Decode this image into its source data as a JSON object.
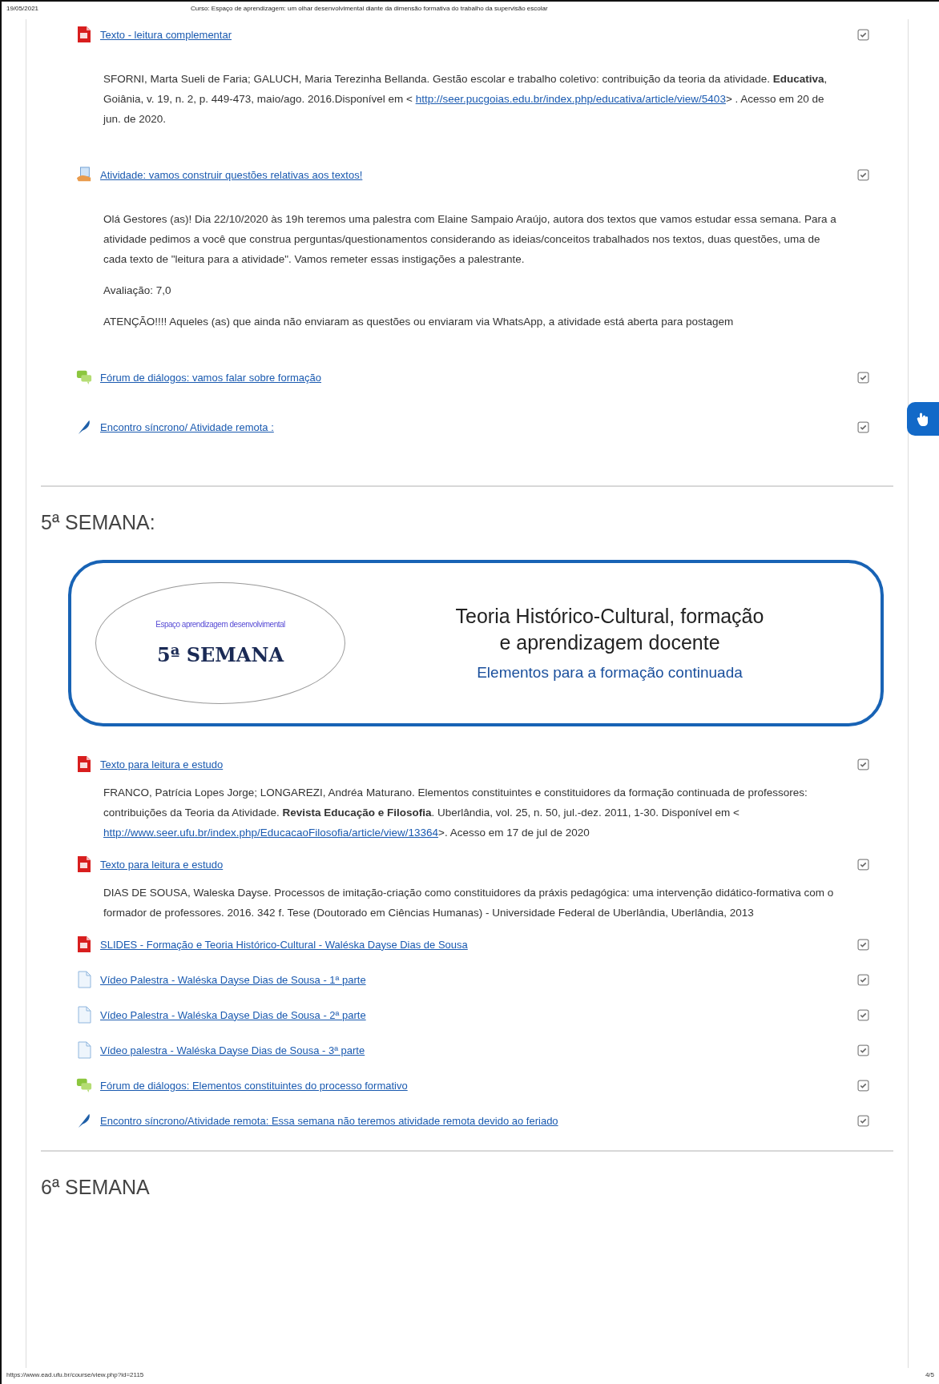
{
  "print_header": {
    "date": "19/05/2021",
    "title": "Curso: Espaço de aprendizagem: um olhar desenvolvimental diante da dimensão formativa do trabalho da supervisão escolar"
  },
  "intro_blocks": [
    {
      "kind": "pdf",
      "label": "Texto - leitura complementar",
      "checked": true
    },
    {
      "kind": "citation",
      "before": "SFORNI, Marta Sueli de Faria; GALUCH, Maria Terezinha Bellanda. Gestão escolar e trabalho coletivo: contribuição da teoria da atividade. **Educativa**, Goiânia, v. 19, n. 2, p. 449-473, maio/ago. 2016.Disponível em <",
      "link": "http://seer.pucgoias.edu.br/index.php/educativa/article/view/5403",
      "after": "> . Acesso em 20 de jun. de 2020."
    },
    {
      "kind": "assignment",
      "label": "Atividade: vamos construir questões relativas aos textos!",
      "checked": true
    },
    {
      "kind": "paragraph",
      "text": "Olá Gestores (as)! Dia 22/10/2020 às 19h teremos uma palestra com Elaine Sampaio Araújo, autora dos textos que vamos estudar essa semana. Para a atividade pedimos a você que construa perguntas/questionamentos considerando as ideias/conceitos trabalhados nos textos, duas questões, uma de cada texto de \"leitura para a atividade\". Vamos remeter essas instigações a palestrante."
    },
    {
      "kind": "paragraph",
      "text": "Avaliação: 7,0"
    },
    {
      "kind": "paragraph",
      "text": "ATENÇÃO!!!! Aqueles (as) que ainda não enviaram as questões ou enviaram  via WhatsApp, a atividade está aberta para  postagem"
    },
    {
      "kind": "forum",
      "label": "Fórum de diálogos: vamos falar sobre formação",
      "checked": true
    },
    {
      "kind": "quill",
      "label": "Encontro síncrono/ Atividade remota :",
      "checked": true
    }
  ],
  "weeks": [
    {
      "heading": "5ª SEMANA:",
      "banner": {
        "caption": "Espaço aprendizagem desenvolvimental",
        "week": "5ª SEMANA",
        "title_lines": [
          "Teoria Histórico-Cultural, formação",
          "e aprendizagem docente"
        ],
        "subtitle": "Elementos para a formação continuada"
      },
      "blocks": [
        {
          "kind": "pdf",
          "label": "Texto para leitura e estudo",
          "checked": true
        },
        {
          "kind": "citation",
          "before": "FRANCO, Patrícia Lopes Jorge; LONGAREZI, Andréa Maturano. Elementos constituintes e constituidores da formação continuada de professores: contribuições da Teoria da Atividade. **Revista Educação e Filosofia**. Uberlândia, vol. 25, n. 50, jul.-dez. 2011, 1-30. Disponível em <",
          "link": "http://www.seer.ufu.br/index.php/EducacaoFilosofia/article/view/13364",
          "after": ">. Acesso em 17 de jul de 2020"
        },
        {
          "kind": "pdf",
          "label": "Texto para leitura e estudo",
          "checked": true
        },
        {
          "kind": "paragraph",
          "text": "DIAS DE SOUSA, Waleska Dayse. Processos de imitação-criação como constituidores da práxis pedagógica: uma intervenção didático-formativa com o formador de professores. 2016. 342 f. Tese (Doutorado em Ciências Humanas) - Universidade Federal de Uberlândia, Uberlândia, 2013"
        },
        {
          "kind": "pdf",
          "label": "SLIDES - Formação e Teoria Histórico-Cultural - Waléska Dayse Dias de Sousa",
          "checked": true
        },
        {
          "kind": "file",
          "label": "Vídeo Palestra - Waléska Dayse Dias de Sousa - 1ª parte",
          "checked": true
        },
        {
          "kind": "file",
          "label": "Vídeo Palestra - Waléska Dayse Dias de Sousa - 2ª parte",
          "checked": true
        },
        {
          "kind": "file",
          "label": "Vídeo palestra - Waléska Dayse Dias de Sousa - 3ª parte",
          "checked": true
        },
        {
          "kind": "forum",
          "label": "Fórum de diálogos: Elementos constituintes do processo formativo",
          "checked": true
        },
        {
          "kind": "quill",
          "label": "Encontro síncrono/Atividade remota: Essa semana não teremos atividade remota devido ao feriado",
          "checked": true
        }
      ]
    },
    {
      "heading": "6ª SEMANA"
    }
  ],
  "print_footer": {
    "url": "https://www.ead.ufu.br/course/view.php?id=2115",
    "page": "4/5"
  }
}
